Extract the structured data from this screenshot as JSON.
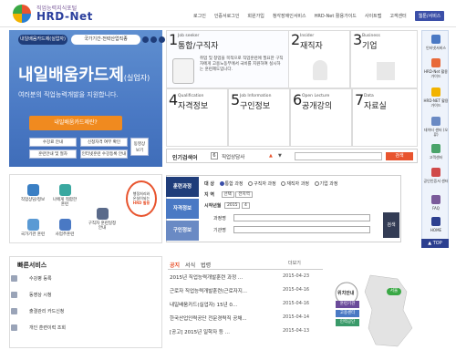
{
  "header": {
    "logo_sub": "직업능력지식포털",
    "logo_main": "HRD-Net",
    "nav": [
      "로그인",
      "인증서로그인",
      "회원가입",
      "청각장애인서비스",
      "HRD-Net 활용가이드",
      "사이트맵",
      "고객센터",
      "웹툰/서비스"
    ]
  },
  "hero": {
    "tab1": "내일배움카드제(실업자)",
    "tab2": "국가기간·전략산업직종",
    "title_main": "내일배움카드제",
    "title_sub": "(실업자)",
    "subtitle": "여러분의 직업능력개발을 지원합니다.",
    "cta": "내일배움카드제란?",
    "buttons": [
      "수강료 안내",
      "신청자격 여부 확인",
      "훈련안내 및 절차",
      "인터넷훈련 수강등록 안내"
    ],
    "video_btn": [
      "동영상",
      "보기"
    ]
  },
  "tiles": [
    {
      "num": "1",
      "en": "Job seeker",
      "ko": "통합/구직자"
    },
    {
      "num": "2",
      "en": "Insider",
      "ko": "재직자"
    },
    {
      "num": "3",
      "en": "Business",
      "ko": "기업"
    },
    {
      "num": "4",
      "en": "Qualification",
      "ko": "자격정보"
    },
    {
      "num": "5",
      "en": "Job Information",
      "ko": "구인정보"
    },
    {
      "num": "6",
      "en": "Open Lecture",
      "ko": "공개강의"
    },
    {
      "num": "7",
      "en": "Data",
      "ko": "자료실"
    }
  ],
  "tile_desc": "취업 및 창업을 목적으로 직업훈련에 필요한 구직자에게 고용노동부에서 국비를 지원하여 실시하는 훈련제도입니다.",
  "job_search": {
    "label": "인기검색어",
    "rank_num": "6",
    "rank_text": "직업상담사",
    "arrow": "▲",
    "btn": "검색"
  },
  "search_panel": {
    "tabs": [
      "훈련과정",
      "자격정보",
      "구인정보"
    ],
    "target_label": "대 상",
    "target_options": [
      "통합 과정",
      "구직자 과정",
      "재직자 과정",
      "기업 과정"
    ],
    "region_label": "지 역",
    "region_sel": [
      "선택",
      "전지역"
    ],
    "start_label": "시작년월",
    "year_sel": "2015",
    "month_sel": "4",
    "course_label": "과정명",
    "org_label": "기관명",
    "submit": "검색"
  },
  "quick": {
    "items": [
      "직업상담/정보",
      "나에게 적합한 훈련",
      "구직자 훈련일정 안내",
      "국가기관 훈련",
      "사업주훈련"
    ],
    "badge": [
      "행정처리와",
      "온실이되는",
      "HRD 활용"
    ]
  },
  "fast_service": {
    "title": "빠른서비스",
    "items": [
      "수강평 등록",
      "동영상 시청",
      "출결관리 카드신청",
      "개인 훈련이력 조회"
    ]
  },
  "notice": {
    "tabs": [
      "공지",
      "서식",
      "법령"
    ],
    "more": "더보기",
    "rows": [
      {
        "title": "2015년 직업능력개발훈련 과정 ...",
        "date": "2015-04-23"
      },
      {
        "title": "근로자 직업능력개발훈련(근로자지...",
        "date": "2015-04-16"
      },
      {
        "title": "내일배움카드(실업자) 15년 0...",
        "date": "2015-04-16"
      },
      {
        "title": "한국산업인력공단 전문경력직 공채...",
        "date": "2015-04-14"
      },
      {
        "title": "[공고] 2015년 일학자 등 ...",
        "date": "2015-04-13"
      }
    ]
  },
  "map": {
    "title": "위치안내",
    "buttons": [
      "훈련기관",
      "고용센터",
      "인력공단"
    ],
    "region": "서울"
  },
  "rail": {
    "items": [
      "인터넷서비스",
      "HRD-Net 활용가이드",
      "HRD-NET 활용가이드",
      "데이터 센터 (오류)",
      "고객센터",
      "공인인증서 센터",
      "FAQ",
      "HOME"
    ],
    "top": "▲ TOP"
  },
  "colors": {
    "brand": "#2b3f9d",
    "accent": "#f08a1f",
    "hero": "#4a79c4",
    "search_btn": "#e8542e"
  }
}
